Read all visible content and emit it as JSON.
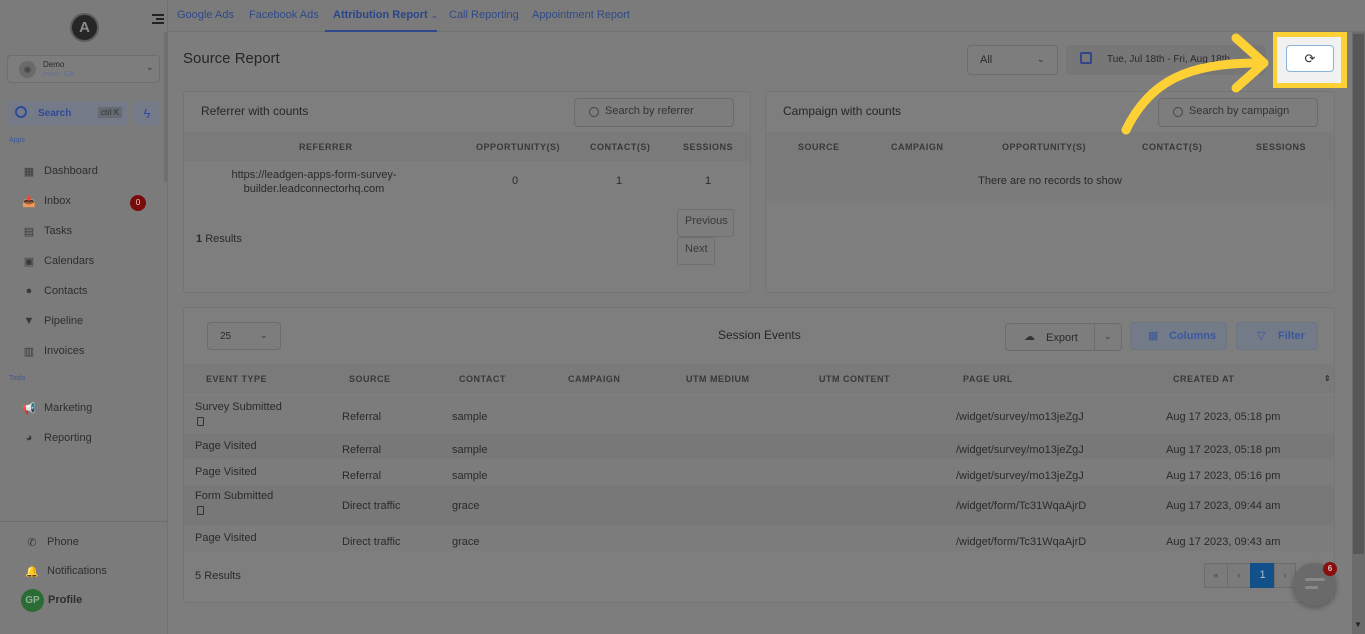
{
  "sidebar": {
    "logo": "A",
    "account": {
      "avatar_icon": "location-pin-icon",
      "name": "Demo",
      "location": "Irvine, CA"
    },
    "search": {
      "label": "Search",
      "shortcut": "ctrl K"
    },
    "sections": {
      "apps": "Apps",
      "tools": "Tools"
    },
    "apps": [
      {
        "label": "Dashboard",
        "icon": "grid-icon"
      },
      {
        "label": "Inbox",
        "icon": "inbox-icon",
        "badge": "0"
      },
      {
        "label": "Tasks",
        "icon": "clipboard-icon"
      },
      {
        "label": "Calendars",
        "icon": "calendar-icon"
      },
      {
        "label": "Contacts",
        "icon": "person-icon"
      },
      {
        "label": "Pipeline",
        "icon": "funnel-icon"
      },
      {
        "label": "Invoices",
        "icon": "invoice-icon"
      }
    ],
    "tools": [
      {
        "label": "Marketing",
        "icon": "megaphone-icon"
      },
      {
        "label": "Reporting",
        "icon": "pie-chart-icon"
      }
    ],
    "bottom": [
      {
        "label": "Phone",
        "icon": "phone-icon"
      },
      {
        "label": "Notifications",
        "icon": "bell-icon"
      },
      {
        "label": "Profile",
        "avatar": "GP"
      }
    ]
  },
  "topnav": {
    "tabs": [
      {
        "label": "Google Ads"
      },
      {
        "label": "Facebook Ads"
      },
      {
        "label": "Attribution Report",
        "active": true
      },
      {
        "label": "Call Reporting"
      },
      {
        "label": "Appointment Report"
      }
    ]
  },
  "header": {
    "title": "Source Report",
    "filter_value": "All",
    "date_range": "Tue, Jul 18th - Fri, Aug 18th",
    "refresh_icon": "refresh-icon"
  },
  "referrer_card": {
    "title": "Referrer with counts",
    "search_placeholder": "Search by referrer",
    "columns": [
      "REFERRER",
      "OPPORTUNITY(S)",
      "CONTACT(S)",
      "SESSIONS"
    ],
    "rows": [
      {
        "referrer_line1": "https://leadgen-apps-form-survey-",
        "referrer_line2": "builder.leadconnectorhq.com",
        "opportunities": "0",
        "contacts": "1",
        "sessions": "1"
      }
    ],
    "results_count": "1",
    "results_label": "Results",
    "previous_label": "Previous",
    "next_label": "Next"
  },
  "campaign_card": {
    "title": "Campaign with counts",
    "search_placeholder": "Search by campaign",
    "columns": [
      "SOURCE",
      "CAMPAIGN",
      "OPPORTUNITY(S)",
      "CONTACT(S)",
      "SESSIONS"
    ],
    "empty_text": "There are no records to show"
  },
  "session_events": {
    "title": "Session Events",
    "page_size": "25",
    "export_label": "Export",
    "columns_label": "Columns",
    "filter_label": "Filter",
    "columns": [
      "EVENT TYPE",
      "SOURCE",
      "CONTACT",
      "CAMPAIGN",
      "UTM MEDIUM",
      "UTM CONTENT",
      "PAGE URL",
      "CREATED AT"
    ],
    "rows": [
      {
        "event_type": "Survey Submitted",
        "has_doc": true,
        "source": "Referral",
        "contact": "sample",
        "campaign": "",
        "utm_medium": "",
        "utm_content": "",
        "page_url": "/widget/survey/mo13jeZgJ",
        "created_at": "Aug 17 2023, 05:18 pm"
      },
      {
        "event_type": "Page Visited",
        "has_doc": false,
        "source": "Referral",
        "contact": "sample",
        "campaign": "",
        "utm_medium": "",
        "utm_content": "",
        "page_url": "/widget/survey/mo13jeZgJ",
        "created_at": "Aug 17 2023, 05:18 pm"
      },
      {
        "event_type": "Page Visited",
        "has_doc": false,
        "source": "Referral",
        "contact": "sample",
        "campaign": "",
        "utm_medium": "",
        "utm_content": "",
        "page_url": "/widget/survey/mo13jeZgJ",
        "created_at": "Aug 17 2023, 05:16 pm"
      },
      {
        "event_type": "Form Submitted",
        "has_doc": true,
        "source": "Direct traffic",
        "contact": "grace",
        "campaign": "",
        "utm_medium": "",
        "utm_content": "",
        "page_url": "/widget/form/Tc31WqaAjrD",
        "created_at": "Aug 17 2023, 09:44 am"
      },
      {
        "event_type": "Page Visited",
        "has_doc": false,
        "source": "Direct traffic",
        "contact": "grace",
        "campaign": "",
        "utm_medium": "",
        "utm_content": "",
        "page_url": "/widget/form/Tc31WqaAjrD",
        "created_at": "Aug 17 2023, 09:43 am"
      }
    ],
    "results_count": "5",
    "results_label": "Results",
    "pagination": {
      "first": "«",
      "prev": "‹",
      "current": "1",
      "next": "›"
    }
  },
  "chat_widget": {
    "badge": "6"
  },
  "colors": {
    "annotation": "#fdd135",
    "accent": "#12508a",
    "badge": "#7a0b0b"
  }
}
